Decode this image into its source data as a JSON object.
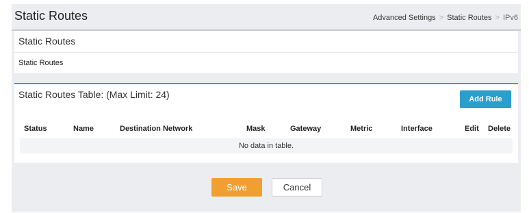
{
  "header": {
    "title": "Static Routes",
    "breadcrumb": [
      "Advanced Settings",
      "Static Routes",
      "IPv6"
    ]
  },
  "panel1": {
    "title": "Static Routes",
    "subtitle": "Static Routes"
  },
  "table": {
    "title": "Static Routes Table: (Max Limit: 24)",
    "add_label": "Add Rule",
    "columns": [
      "Status",
      "Name",
      "Destination Network",
      "Mask",
      "Gateway",
      "Metric",
      "Interface",
      "Edit",
      "Delete"
    ],
    "empty_text": "No data in table."
  },
  "actions": {
    "save_label": "Save",
    "cancel_label": "Cancel"
  },
  "colors": {
    "accent": "#2b9fcc",
    "save": "#f0a030",
    "background": "#ecedf1"
  }
}
